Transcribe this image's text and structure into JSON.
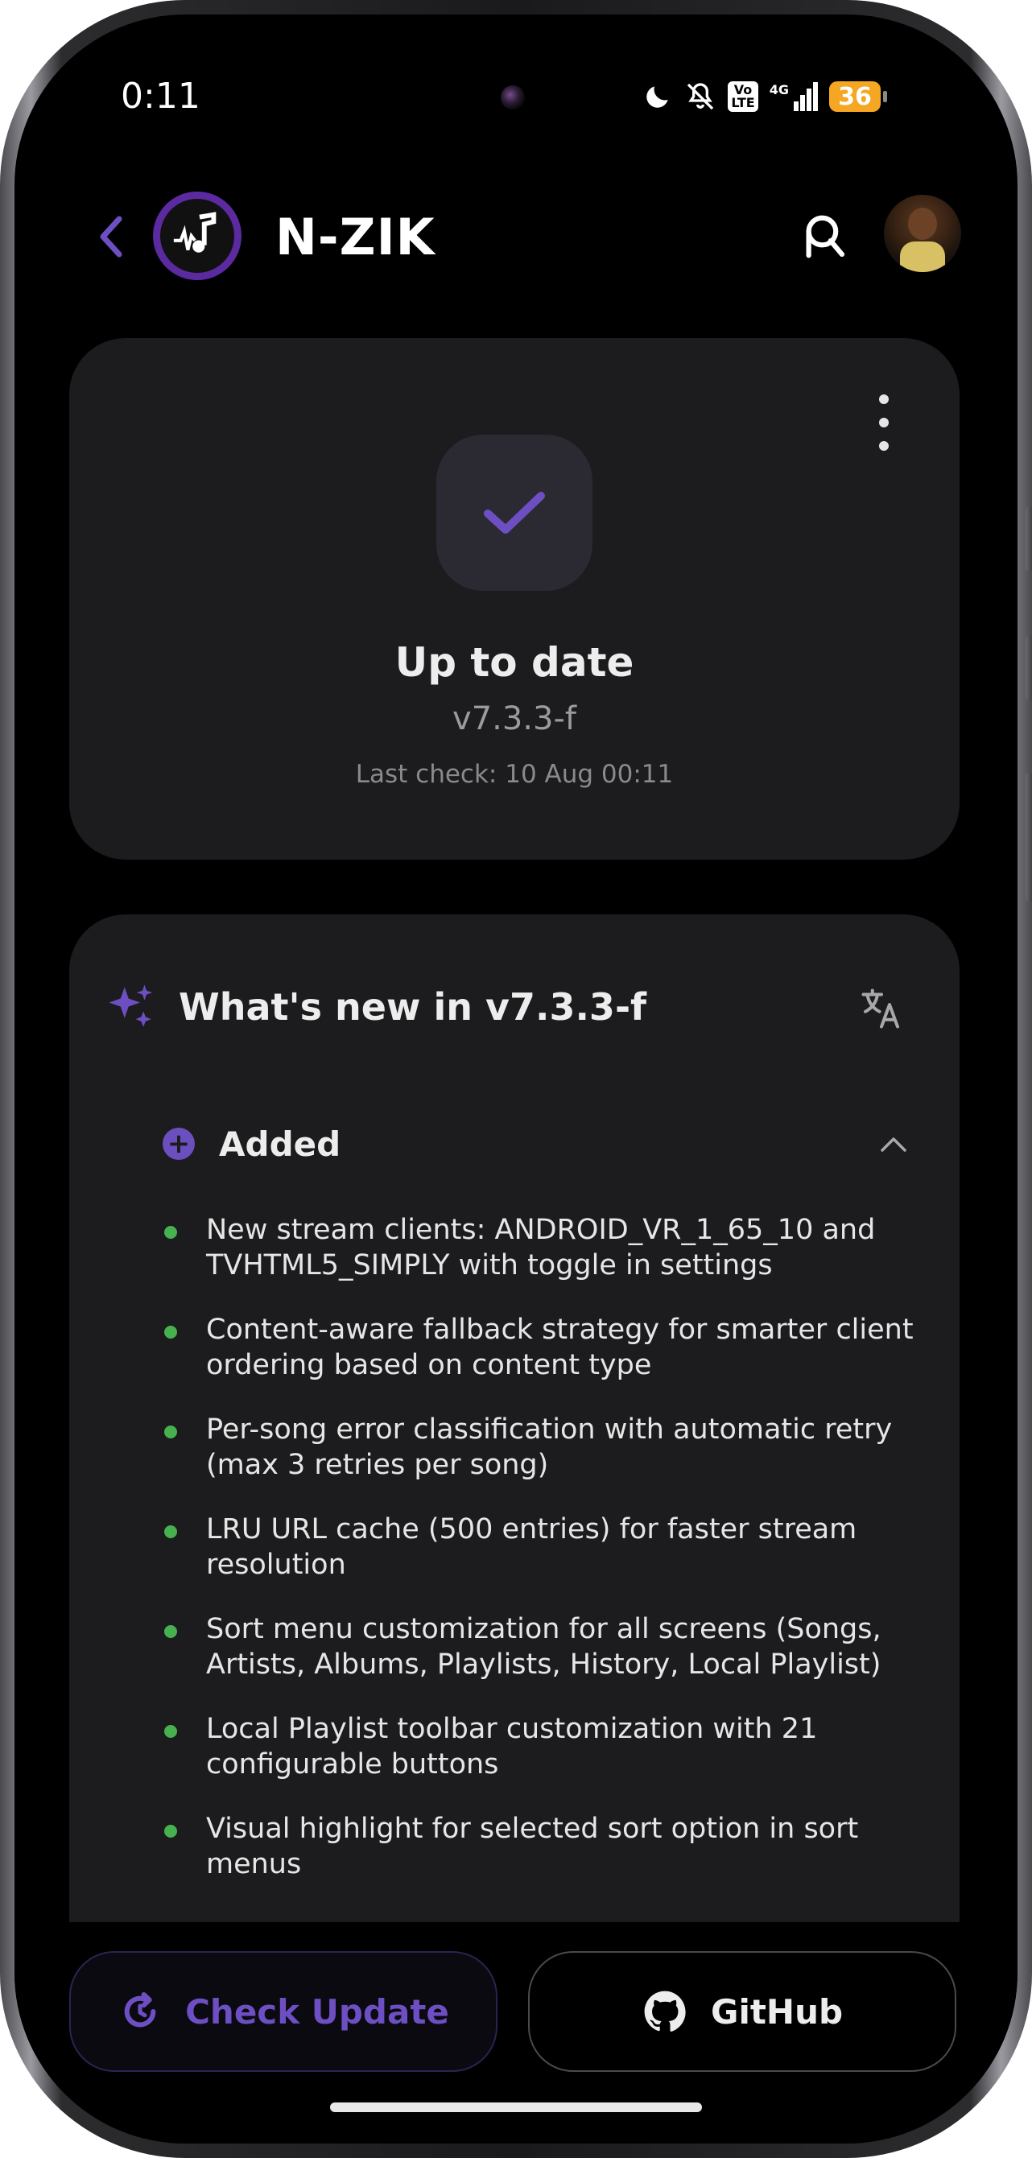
{
  "status_bar": {
    "time": "0:11",
    "network": "4G",
    "volte": "Vo LTE",
    "battery": "36",
    "icons": [
      "moon-icon",
      "silent-bell-icon",
      "volte-icon",
      "signal-icon",
      "battery-icon"
    ]
  },
  "app_bar": {
    "title": "N-ZIK",
    "back_icon": "chevron-left-icon",
    "search_icon": "search-icon",
    "avatar": "profile-avatar"
  },
  "status_card": {
    "title": "Up to date",
    "version": "v7.3.3-f",
    "last_check": "Last check: 10 Aug 00:11"
  },
  "changelog": {
    "title": "What's new in v7.3.3-f",
    "section_label": "Added",
    "items": [
      "New stream clients: ANDROID_VR_1_65_10 and TVHTML5_SIMPLY with toggle in settings",
      "Content-aware fallback strategy for smarter client ordering based on content type",
      "Per-song error classification with automatic retry (max 3 retries per song)",
      "LRU URL cache (500 entries) for faster stream resolution",
      "Sort menu customization for all screens (Songs, Artists, Albums, Playlists, History, Local Playlist)",
      "Local Playlist toolbar customization with 21 configurable buttons",
      "Visual highlight for selected sort option in sort menus"
    ]
  },
  "buttons": {
    "check_update": "Check Update",
    "github": "GitHub"
  },
  "colors": {
    "accent": "#6d4fc3",
    "bullet": "#46b14e",
    "card": "#1c1c1e",
    "background": "#000000",
    "battery": "#f5a623"
  }
}
